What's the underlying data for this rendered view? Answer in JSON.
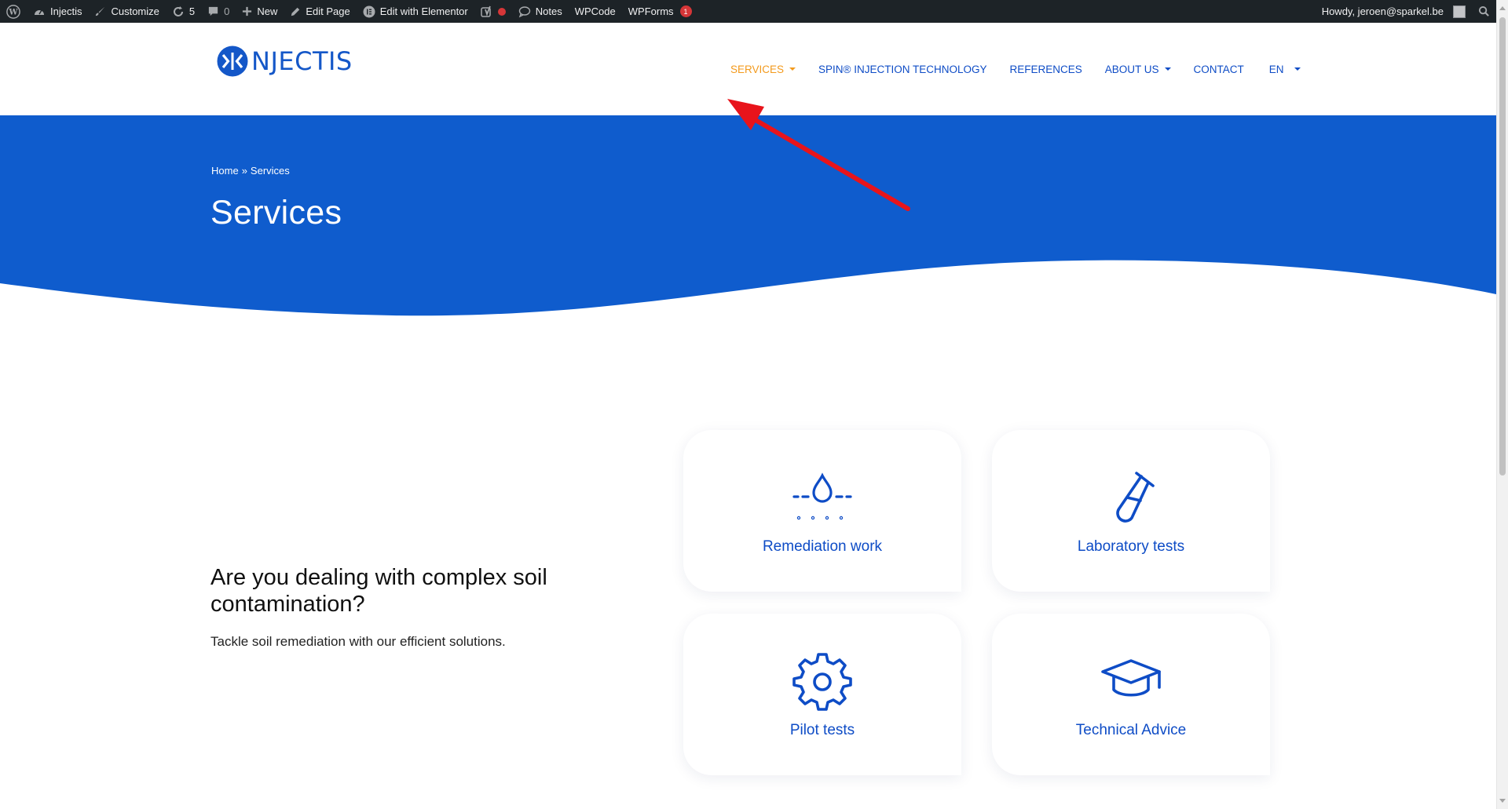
{
  "admin_bar": {
    "site_name": "Injectis",
    "customize": "Customize",
    "updates_count": "5",
    "comments_count": "0",
    "new": "New",
    "edit_page": "Edit Page",
    "edit_elementor": "Edit with Elementor",
    "notes": "Notes",
    "wpcode": "WPCode",
    "wpforms": "WPForms",
    "wpforms_badge": "1",
    "howdy": "Howdy, jeroen@sparkel.be"
  },
  "header": {
    "logo_text": "NJECTIS",
    "nav": [
      {
        "label": "SERVICES",
        "active": true
      },
      {
        "label": "SPIN® INJECTION TECHNOLOGY"
      },
      {
        "label": "REFERENCES"
      },
      {
        "label": "ABOUT US"
      },
      {
        "label": "CONTACT"
      },
      {
        "label": "EN"
      }
    ]
  },
  "hero": {
    "breadcrumb_home": "Home",
    "breadcrumb_sep": "»",
    "breadcrumb_current": "Services",
    "title": "Services"
  },
  "intro": {
    "heading": "Are you dealing with complex soil contamination?",
    "text": "Tackle soil remediation with our efficient solutions."
  },
  "services": [
    {
      "label": "Remediation work",
      "icon": "water-drop-icon"
    },
    {
      "label": "Laboratory tests",
      "icon": "test-tube-icon"
    },
    {
      "label": "Pilot tests",
      "icon": "gear-icon"
    },
    {
      "label": "Technical Advice",
      "icon": "graduation-cap-icon"
    }
  ],
  "colors": {
    "brand_blue": "#0f5ccd",
    "nav_active": "#f39a1c",
    "admin_bar": "#1d2327",
    "annotation_arrow": "#e8141b"
  }
}
